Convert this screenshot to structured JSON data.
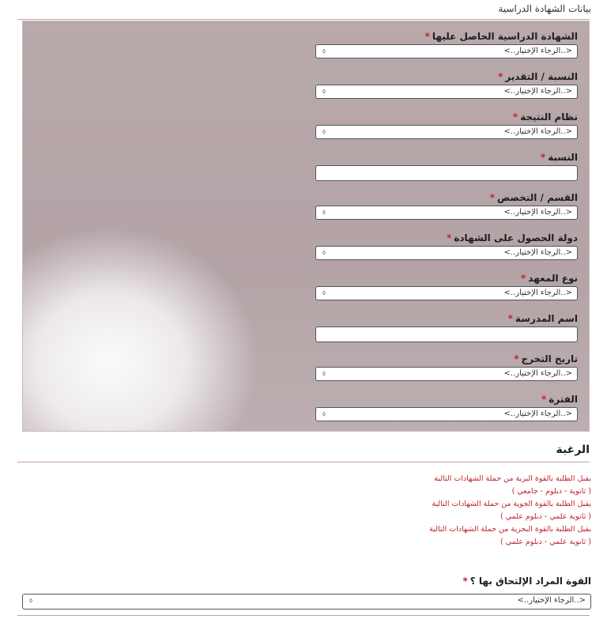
{
  "certificate_section": {
    "title": "بيانات الشهادة الدراسية",
    "fields": [
      {
        "label": "الشهادة الدراسية الحاصل عليها",
        "required": "*",
        "type": "select",
        "value": "<..الرجاء الإختيار..>"
      },
      {
        "label": "النسبة / التقدير",
        "required": "*",
        "type": "select",
        "value": "<..الرجاء الإختيار..>"
      },
      {
        "label": "نظام النتيجة",
        "required": "*",
        "type": "select",
        "value": "<..الرجاء الإختيار..>"
      },
      {
        "label": "النسبة",
        "required": "*",
        "type": "text",
        "value": ""
      },
      {
        "label": "القسم / التخصص",
        "required": "*",
        "type": "select",
        "value": "<..الرجاء الإختيار..>"
      },
      {
        "label": "دولة الحصول على الشهادة",
        "required": "*",
        "type": "select",
        "value": "<..الرجاء الإختيار..>"
      },
      {
        "label": "نوع المعهد",
        "required": "*",
        "type": "select",
        "value": "<..الرجاء الإختيار..>"
      },
      {
        "label": "اسم المدرسة",
        "required": "*",
        "type": "text",
        "value": ""
      },
      {
        "label": "تاريخ التخرج",
        "required": "*",
        "type": "select",
        "value": "<..الرجاء الإختيار..>"
      },
      {
        "label": "الفترة",
        "required": "*",
        "type": "select",
        "value": "<..الرجاء الإختيار..>"
      }
    ]
  },
  "desire_section": {
    "title": "الرغبة",
    "notes": [
      "يقبل الطلبة بالقوة البرية من حملة الشهادات التالية",
      "( ثانوية - دبلوم - جامعي )",
      "يقبل الطلبة بالقوة الجوية من حملة الشهادات التالية",
      "( ثانوية علمي - دبلوم علمي )",
      "يقبل الطلبة بالقوة البحرية من حملة الشهادات التالية",
      "( ثانوية علمي - دبلوم علمي )"
    ],
    "force_label": "القوة المراد الإلتحاق بها ؟",
    "force_required": "*",
    "force_value": "<..الرجاء الإختيار..>"
  },
  "icons": {
    "select_chevron": "⬨"
  },
  "colors": {
    "required": "#d0202a",
    "notes": "#c0242e",
    "panel": "#b8a9ab"
  }
}
